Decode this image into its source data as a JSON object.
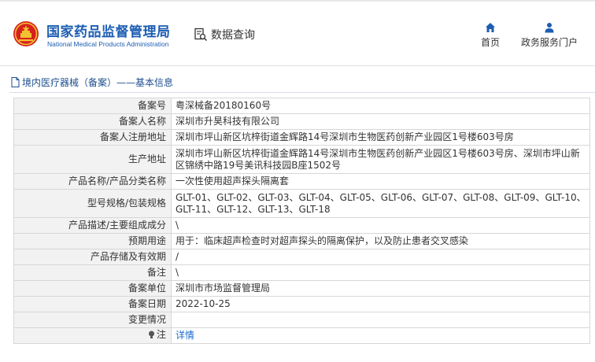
{
  "header": {
    "brand_cn": "国家药品监督管理局",
    "brand_en": "National Medical Products Administration",
    "query_label": "数据查询",
    "nav": {
      "home": "首页",
      "gov_service": "政务服务门户"
    },
    "colors": {
      "brand": "#1d5eb3",
      "emblem_red": "#d7201e",
      "emblem_gold": "#f2c230"
    }
  },
  "section": {
    "title": "境内医疗器械（备案）——基本信息"
  },
  "table": {
    "rows": [
      {
        "key": "备案号",
        "value": "粤深械备20180160号"
      },
      {
        "key": "备案人名称",
        "value": "深圳市升昊科技有限公司"
      },
      {
        "key": "备案人注册地址",
        "value": "深圳市坪山新区坑梓街道金辉路14号深圳市生物医药创新产业园区1号楼603号房"
      },
      {
        "key": "生产地址",
        "value": "深圳市坪山新区坑梓街道金辉路14号深圳市生物医药创新产业园区1号楼603号房、深圳市坪山新区锦绣中路19号美讯科技园B座1502号"
      },
      {
        "key": "产品名称/产品分类名称",
        "value": "一次性使用超声探头隔离套"
      },
      {
        "key": "型号规格/包装规格",
        "value": "GLT-01、GLT-02、GLT-03、GLT-04、GLT-05、GLT-06、GLT-07、GLT-08、GLT-09、GLT-10、GLT-11、GLT-12、GLT-13、GLT-18"
      },
      {
        "key": "产品描述/主要组成成分",
        "value": "\\"
      },
      {
        "key": "预期用途",
        "value": "用于：临床超声检查时对超声探头的隔离保护，以及防止患者交叉感染"
      },
      {
        "key": "产品存储及有效期",
        "value": "/"
      },
      {
        "key": "备注",
        "value": "\\"
      },
      {
        "key": "备案单位",
        "value": "深圳市市场监督管理局"
      },
      {
        "key": "备案日期",
        "value": "2022-10-25"
      },
      {
        "key": "变更情况",
        "value": ""
      },
      {
        "key": "注",
        "value": "详情"
      }
    ]
  }
}
